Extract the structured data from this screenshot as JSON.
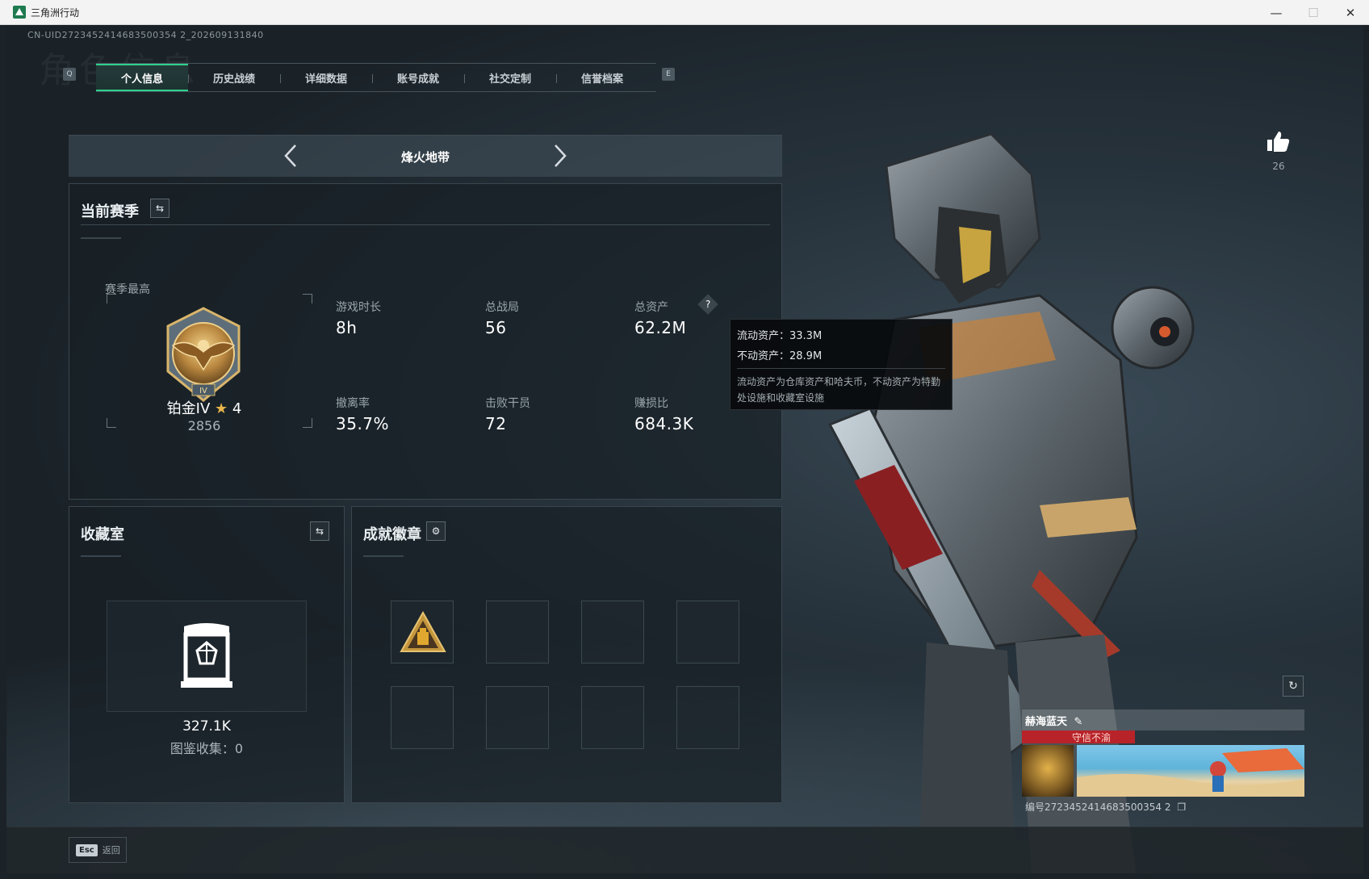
{
  "window": {
    "title": "三角洲行动",
    "controls": {
      "minimize": "—",
      "maximize": "☐",
      "close": "✕"
    }
  },
  "uid_line": "CN-UID2723452414683500354 2_202609131840",
  "ghost_title": "角色信息",
  "tabs": {
    "prev_key": "Q",
    "next_key": "E",
    "items": [
      {
        "label": "个人信息",
        "active": true
      },
      {
        "label": "历史战绩"
      },
      {
        "label": "详细数据"
      },
      {
        "label": "账号成就"
      },
      {
        "label": "社交定制"
      },
      {
        "label": "信誉档案"
      }
    ]
  },
  "map_selector": {
    "title": "烽火地带",
    "prev": "‹",
    "next": "›"
  },
  "season": {
    "title": "当前赛季",
    "best_label": "赛季最高",
    "rank_name": "铂金IV",
    "rank_stars": "4",
    "rank_score": "2856",
    "stats": [
      {
        "label": "游戏时长",
        "value": "8h"
      },
      {
        "label": "总战局",
        "value": "56"
      },
      {
        "label": "总资产",
        "value": "62.2M"
      },
      {
        "label": "撤离率",
        "value": "35.7%"
      },
      {
        "label": "击败干员",
        "value": "72"
      },
      {
        "label": "赚损比",
        "value": "684.3K"
      }
    ]
  },
  "tooltip": {
    "liquid": "流动资产：33.3M",
    "fixed": "不动资产：28.9M",
    "desc": "流动资产为仓库资产和哈夫币，不动资产为特勤处设施和收藏室设施"
  },
  "collection": {
    "title": "收藏室",
    "value": "327.1K",
    "catalog": "图鉴收集：0"
  },
  "badges": {
    "title": "成就徽章"
  },
  "likes": {
    "count": "26"
  },
  "player_card": {
    "name": "赫海蓝天",
    "motto": "守信不渝",
    "id": "编号2723452414683500354 2"
  },
  "bottom": {
    "esc_key": "Esc",
    "esc_label": "返回"
  },
  "colors": {
    "accent": "#2fd18c",
    "tooltip_bg": "#080a0c",
    "banner_red": "#b8232a"
  }
}
